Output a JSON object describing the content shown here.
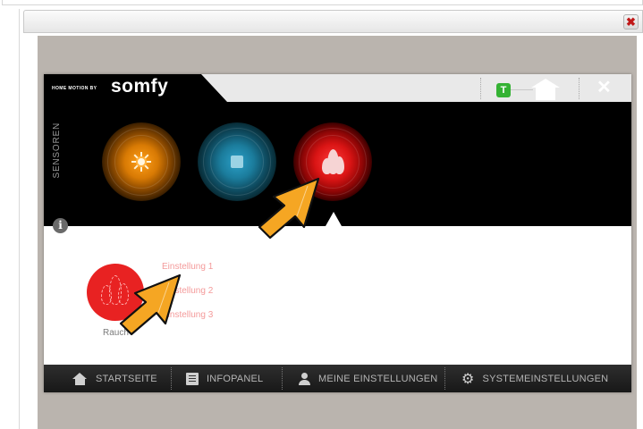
{
  "dialog": {
    "close_symbol": "✖"
  },
  "header": {
    "brand_prefix": "HOME MOTION BY",
    "brand_name": "somfy",
    "tahoma_badge": "T",
    "close_symbol": "✕"
  },
  "sensors": {
    "label": "SENSOREN",
    "items": [
      {
        "name": "sun-sensor",
        "color": "#f39a10"
      },
      {
        "name": "cool-sensor",
        "color": "#1f88ad"
      },
      {
        "name": "fire-sensor",
        "color": "#e12020",
        "selected": true
      }
    ]
  },
  "info_symbol": "i",
  "detail": {
    "sensor_label": "Rauch",
    "settings": [
      "Einstellung 1",
      "Einstellung 2",
      "Einstellung 3"
    ]
  },
  "nav": {
    "items": [
      {
        "label": "STARTSEITE",
        "icon": "home-icon"
      },
      {
        "label": "INFOPANEL",
        "icon": "document-icon"
      },
      {
        "label": "MEINE EINSTELLUNGEN",
        "icon": "user-icon"
      },
      {
        "label": "SYSTEMEINSTELLUNGEN",
        "icon": "gear-icon"
      }
    ]
  },
  "colors": {
    "accent_arrow": "#f5a623",
    "fire_red": "#e82222",
    "setting_link": "#f49a9a"
  }
}
